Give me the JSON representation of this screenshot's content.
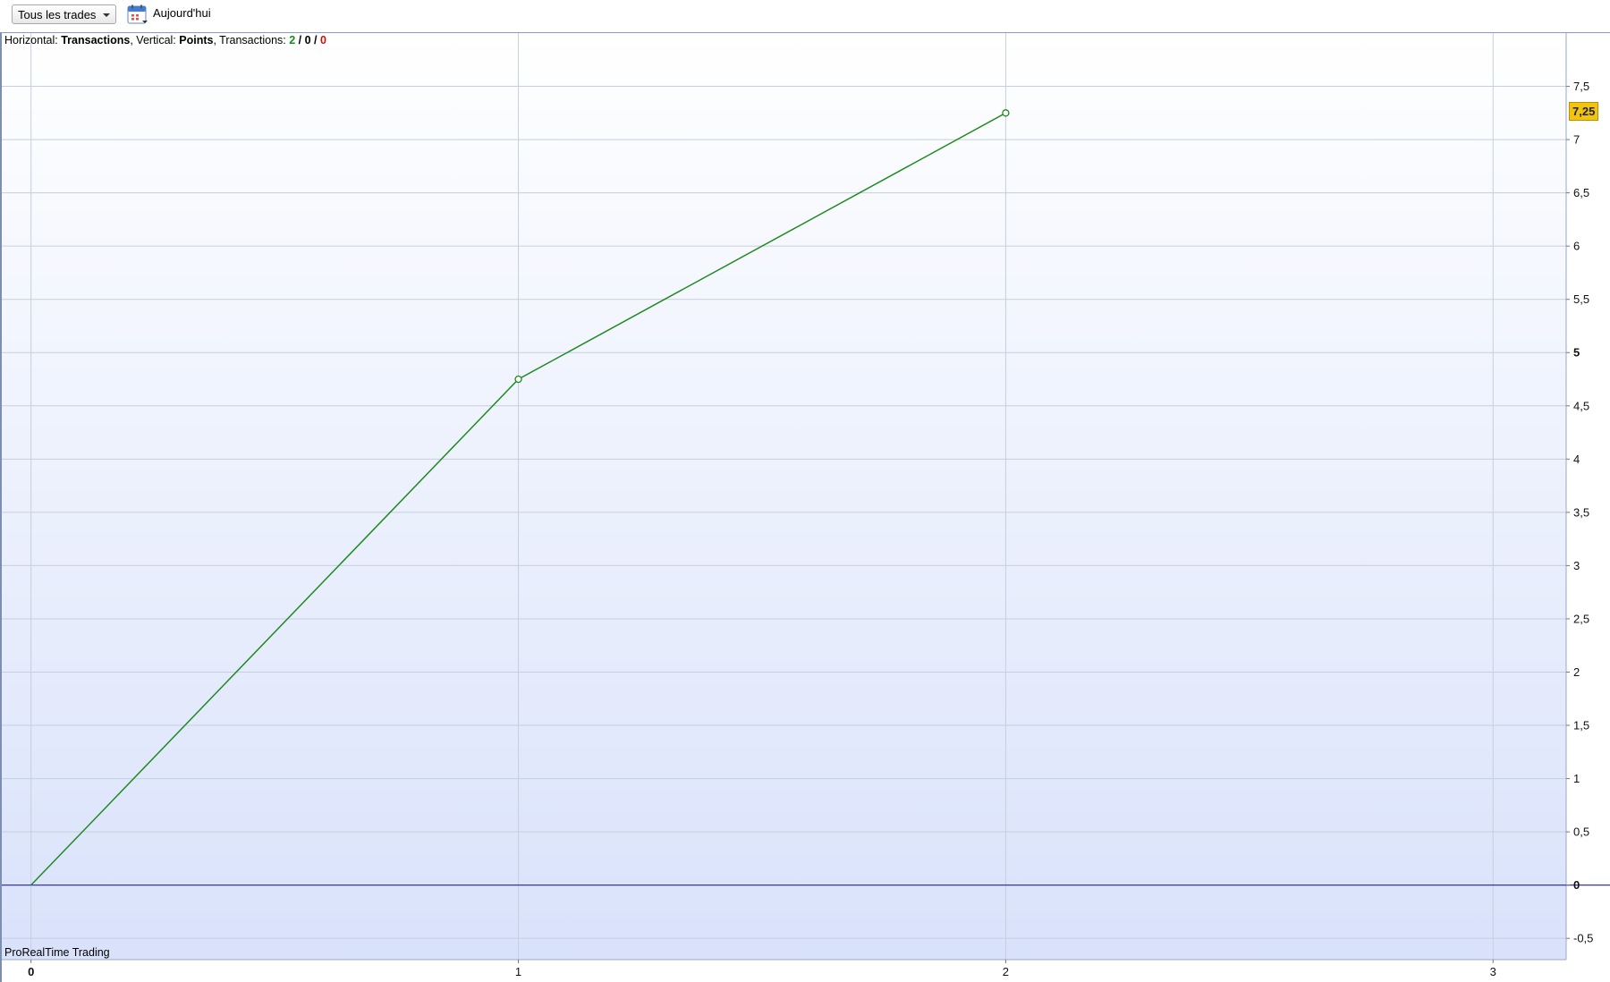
{
  "toolbar": {
    "filter_label": "Tous les trades",
    "period_label": "Aujourd'hui",
    "calendar_icon": "calendar-icon"
  },
  "header": {
    "horizontal_label": "Horizontal: ",
    "horizontal_value": "Transactions",
    "vertical_label": ", Vertical: ",
    "vertical_value": "Points",
    "transactions_label": ", Transactions: ",
    "count_win": "2",
    "count_neutral": "0",
    "count_loss": "0",
    "sep": " / "
  },
  "footer": {
    "brand": "ProRealTime Trading"
  },
  "last_value_label": "7,25",
  "colors": {
    "line": "#1f8a1f",
    "zero_line": "#3333cc",
    "grid": "#c5cfdd",
    "bg_top": "#ffffff",
    "bg_bottom": "#d9e2fb",
    "badge": "#f1c40f"
  },
  "chart_data": {
    "type": "line",
    "x": [
      0,
      1,
      2
    ],
    "series": [
      {
        "values": [
          0,
          4.75,
          7.25
        ]
      }
    ],
    "xlim": [
      -0.06,
      3.15
    ],
    "ylim": [
      -0.7,
      8.0
    ],
    "x_ticks": [
      0,
      1,
      2,
      3
    ],
    "x_tick_labels": [
      "0",
      "1",
      "2",
      "3"
    ],
    "y_ticks": [
      -0.5,
      0,
      0.5,
      1,
      1.5,
      2,
      2.5,
      3,
      3.5,
      4,
      4.5,
      5,
      5.5,
      6,
      6.5,
      7,
      7.5
    ],
    "y_tick_labels": [
      "-0,5",
      "0",
      "0,5",
      "1",
      "1,5",
      "2",
      "2,5",
      "3",
      "3,5",
      "4",
      "4,5",
      "5",
      "5,5",
      "6",
      "6,5",
      "7",
      "7,5"
    ],
    "bold_y_ticks": [
      "0",
      "5"
    ],
    "bold_x_ticks": [
      "0"
    ],
    "grid": true,
    "y_axis_position": "right"
  }
}
